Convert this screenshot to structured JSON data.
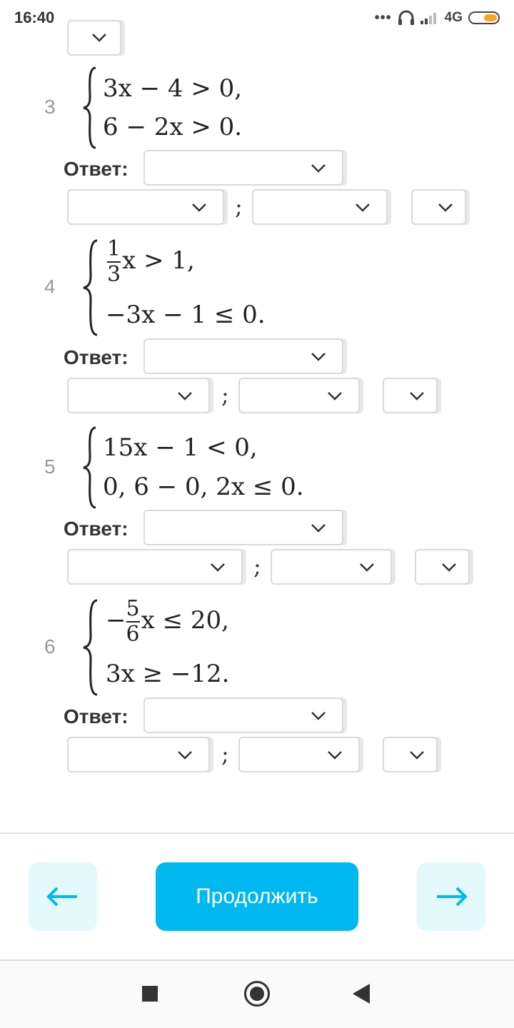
{
  "status_bar": {
    "time": "16:40",
    "signal_dots": "•••",
    "network": "4G"
  },
  "answer_label": "Ответ:",
  "separator": ";",
  "problems": [
    {
      "number": "3",
      "line1": "3x − 4 > 0,",
      "line2": "6 − 2x > 0."
    },
    {
      "number": "4",
      "line1_frac_num": "1",
      "line1_frac_den": "3",
      "line1_rest": "x > 1,",
      "line2": "−3x − 1 ≤ 0."
    },
    {
      "number": "5",
      "line1": "15x − 1 < 0,",
      "line2": "0, 6 − 0, 2x ≤ 0."
    },
    {
      "number": "6",
      "line1_sign": "−",
      "line1_frac_num": "5",
      "line1_frac_den": "6",
      "line1_rest": "x ≤ 20,",
      "line2": "3x ≥ −12."
    }
  ],
  "selects": {
    "selected_value": ""
  },
  "footer": {
    "continue_label": "Продолжить"
  },
  "icons": {
    "back": "arrow-left-icon",
    "next": "arrow-right-icon",
    "dropdown": "chevron-down-icon"
  },
  "colors": {
    "accent": "#00b8f0",
    "nav_bg": "#e3f9fb",
    "battery": "#f5a623"
  }
}
